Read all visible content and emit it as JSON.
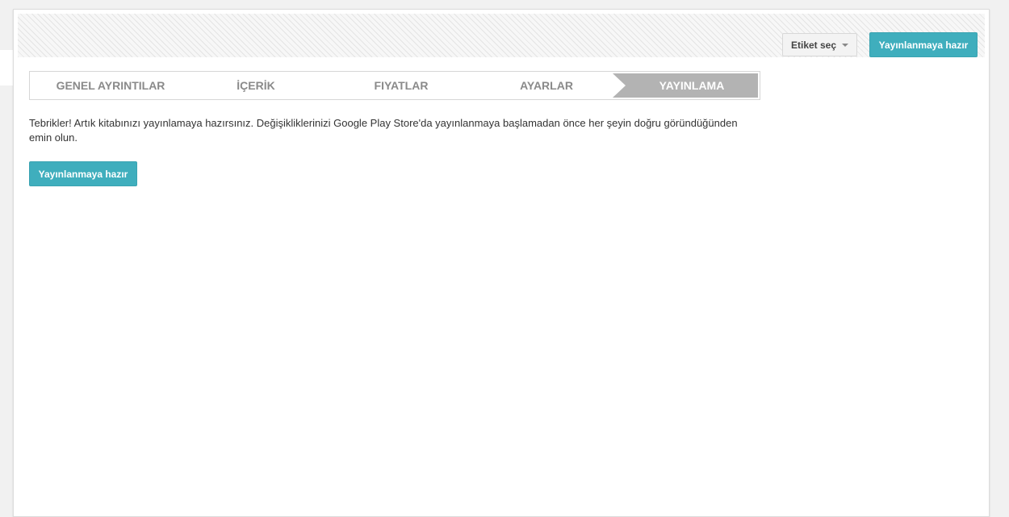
{
  "header": {
    "label_select": "Etiket seç",
    "publish_ready_button": "Yayınlanmaya hazır"
  },
  "steps": [
    {
      "label": "GENEL AYRINTILAR",
      "active": false
    },
    {
      "label": "İÇERİK",
      "active": false
    },
    {
      "label": "FIYATLAR",
      "active": false
    },
    {
      "label": "AYARLAR",
      "active": false
    },
    {
      "label": "YAYINLAMA",
      "active": true
    }
  ],
  "main": {
    "message": "Tebrikler! Artık kitabınızı yayınlamaya hazırsınız. Değişikliklerinizi Google Play Store'da yayınlanmaya başlamadan önce her şeyin doğru göründüğünden emin olun.",
    "publish_ready_button": "Yayınlanmaya hazır"
  },
  "colors": {
    "accent": "#3faebd",
    "active_step": "#b3b3b3",
    "step_text": "#8a8a8a"
  }
}
